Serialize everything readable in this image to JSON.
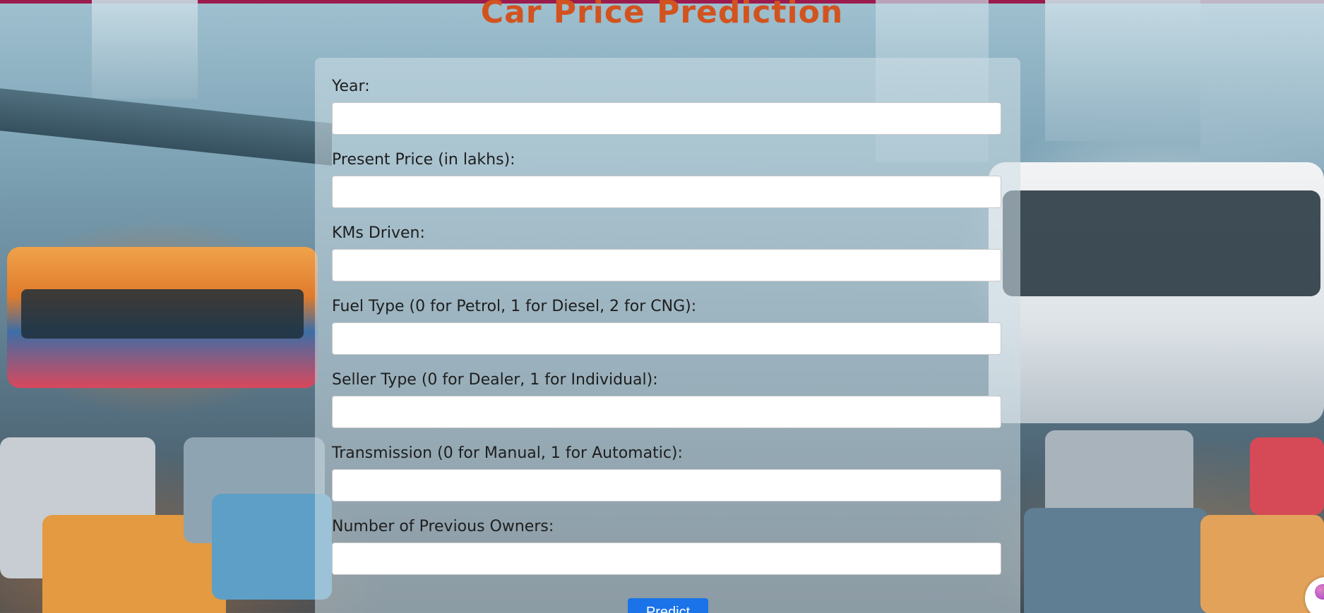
{
  "page": {
    "title": "Car Price Prediction",
    "accent_color": "#d2531f",
    "top_bar_color": "#9b1b4e"
  },
  "form": {
    "fields": [
      {
        "label": "Year:",
        "value": "",
        "placeholder": ""
      },
      {
        "label": "Present Price (in lakhs):",
        "value": "",
        "placeholder": ""
      },
      {
        "label": "KMs Driven:",
        "value": "",
        "placeholder": ""
      },
      {
        "label": "Fuel Type (0 for Petrol, 1 for Diesel, 2 for CNG):",
        "value": "",
        "placeholder": ""
      },
      {
        "label": "Seller Type (0 for Dealer, 1 for Individual):",
        "value": "",
        "placeholder": ""
      },
      {
        "label": "Transmission (0 for Manual, 1 for Automatic):",
        "value": "",
        "placeholder": ""
      },
      {
        "label": "Number of Previous Owners:",
        "value": "",
        "placeholder": ""
      }
    ],
    "submit_label": "Predict",
    "submit_color": "#1a73e8"
  },
  "widget": {
    "icon": "assistant-bubble-icon"
  }
}
